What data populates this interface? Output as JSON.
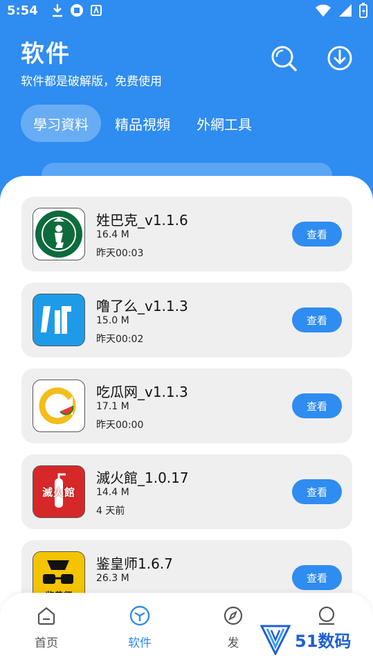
{
  "status": {
    "time": "5:54"
  },
  "header": {
    "title": "软件",
    "subtitle": "软件都是破解版，免费使用"
  },
  "tabs": [
    {
      "label": "學习資料",
      "active": true
    },
    {
      "label": "精品視頻",
      "active": false
    },
    {
      "label": "外網工具",
      "active": false
    }
  ],
  "apps": [
    {
      "name": "姓巴克_v1.1.6",
      "size": "16.4 M",
      "time": "昨天00:03",
      "button": "查看",
      "icon": "starbucks-parody-icon"
    },
    {
      "name": "噜了么_v1.1.3",
      "size": "15.0 M",
      "time": "昨天00:02",
      "button": "查看",
      "icon": "lu-le-me-icon"
    },
    {
      "name": "吃瓜网_v1.1.3",
      "size": "17.1 M",
      "time": "昨天00:00",
      "button": "查看",
      "icon": "watermelon-icon"
    },
    {
      "name": "滅火館_1.0.17",
      "size": "14.4 M",
      "time": "4 天前",
      "button": "查看",
      "icon": "fire-extinguisher-icon"
    },
    {
      "name": "鉴皇师1.6.7",
      "size": "26.3 M",
      "time": "",
      "button": "查看",
      "icon": "glasses-icon"
    }
  ],
  "icon_texts": {
    "miehuoguan": "滅火館",
    "jianhuangshi": "鉴黄师"
  },
  "nav": [
    {
      "label": "首页",
      "active": false
    },
    {
      "label": "软件",
      "active": true
    },
    {
      "label": "发",
      "active": false
    },
    {
      "label": "",
      "active": false
    }
  ],
  "watermark": {
    "text": "51数码"
  },
  "colors": {
    "primary": "#2f8cf0",
    "card": "#efefef"
  }
}
